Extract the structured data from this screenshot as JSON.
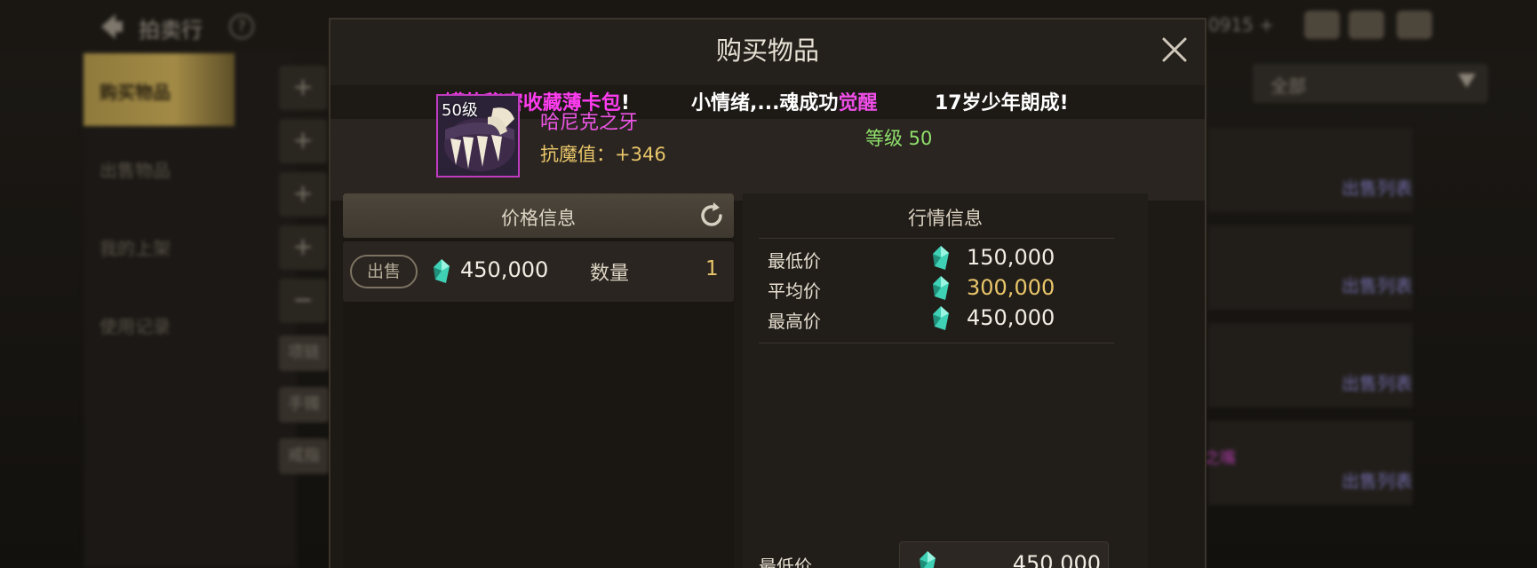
{
  "background": {
    "title": "拍卖行",
    "help_glyph": "?",
    "currency_text": "0915 +",
    "sidebar": [
      "购买物品",
      "出售物品",
      "我的上架",
      "使用记录"
    ],
    "mid_buttons": [
      "+",
      "+",
      "+",
      "+",
      "−"
    ],
    "mid_chips": [
      "项链",
      "手镯",
      "戒指"
    ],
    "filter": {
      "label": "全部"
    },
    "row_links": [
      "出售列表",
      "出售列表",
      "出售列表",
      "出售列表"
    ],
    "purple_fragment": "之嘴"
  },
  "modal": {
    "title": "购买物品",
    "close_glyph": "✕",
    "marquee": {
      "msg1": ":罐的秘密收藏薄卡包",
      "msg1_excl": "!",
      "msg2_pre": "小情绪,...魂成功",
      "msg2_hl": "觉醒",
      "msg3": "17岁少年朗成!"
    },
    "item": {
      "level_badge": "50级",
      "name": "哈尼克之牙",
      "stat": "抗魔值：+346",
      "grade": "等级 50"
    },
    "price_info": {
      "header": "价格信息",
      "sell_button": "出售",
      "price": "450,000",
      "qty_label": "数量",
      "qty_value": "1"
    },
    "market_info": {
      "header": "行情信息",
      "rows": [
        {
          "label": "最低价",
          "value": "150,000"
        },
        {
          "label": "平均价",
          "value": "300,000"
        },
        {
          "label": "最高价",
          "value": "450,000"
        }
      ]
    },
    "min_price": {
      "label": "最低价",
      "value": "450,000"
    }
  },
  "colors": {
    "gold": "#e9c66a",
    "magenta": "#ee55e6",
    "green": "#8fe06c",
    "gem": "#3fd1b5"
  }
}
